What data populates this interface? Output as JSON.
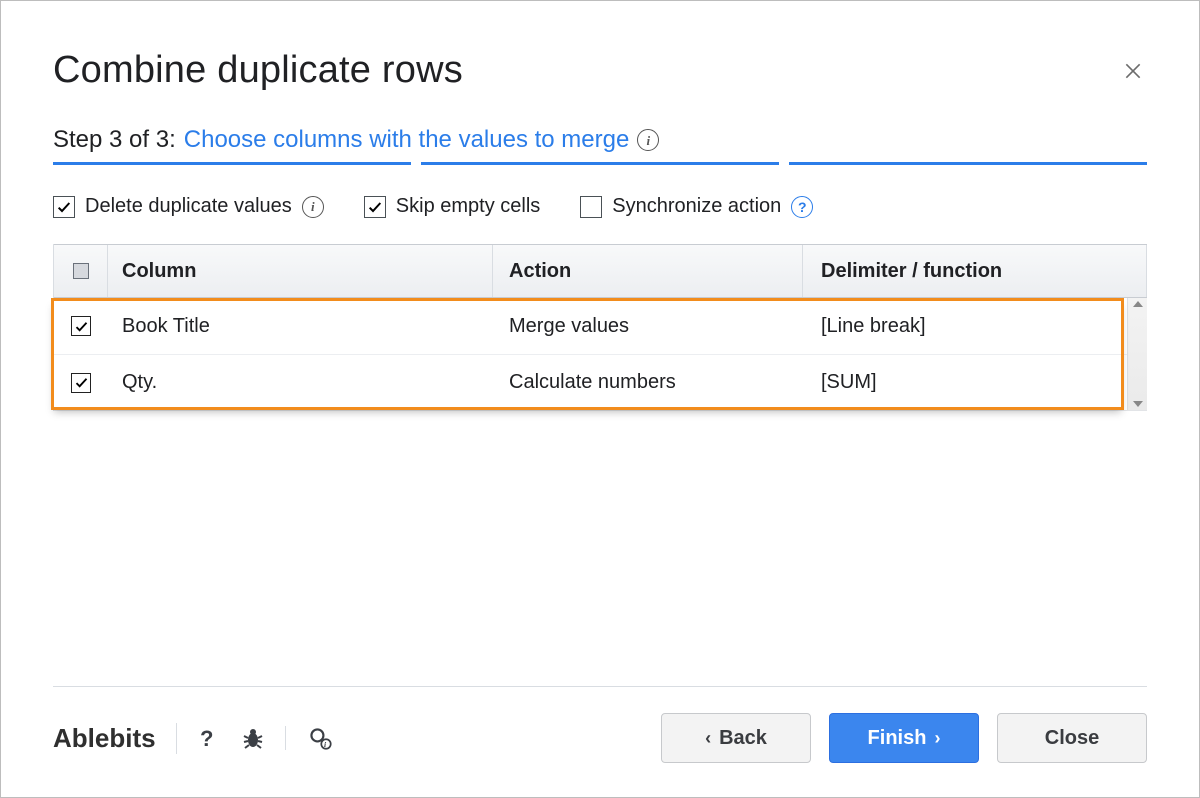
{
  "title": "Combine duplicate rows",
  "step": {
    "prefix": "Step 3 of 3:",
    "description": "Choose columns with the values to merge"
  },
  "options": [
    {
      "label": "Delete duplicate values",
      "checked": true,
      "info": true,
      "help": false
    },
    {
      "label": "Skip empty cells",
      "checked": true,
      "info": false,
      "help": false
    },
    {
      "label": "Synchronize action",
      "checked": false,
      "info": false,
      "help": true
    }
  ],
  "table": {
    "headers": {
      "column": "Column",
      "action": "Action",
      "delimiter": "Delimiter / function"
    },
    "rows": [
      {
        "checked": true,
        "column": "Book Title",
        "action": "Merge values",
        "delimiter": "[Line break]"
      },
      {
        "checked": true,
        "column": "Qty.",
        "action": "Calculate numbers",
        "delimiter": "[SUM]"
      }
    ]
  },
  "footer": {
    "brand": "Ablebits",
    "back": "Back",
    "finish": "Finish",
    "close": "Close"
  }
}
